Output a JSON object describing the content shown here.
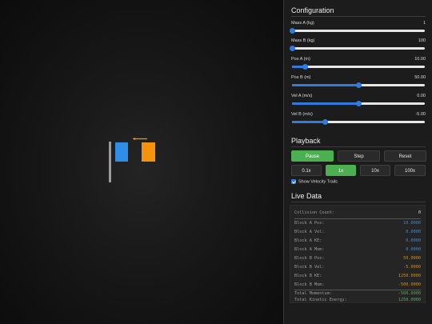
{
  "config": {
    "title": "Configuration",
    "params": [
      {
        "label": "Mass A (kg)",
        "value": "1",
        "fraction": 0.0
      },
      {
        "label": "Mass B (kg)",
        "value": "100",
        "fraction": 0.0
      },
      {
        "label": "Pos A (m)",
        "value": "10.00",
        "fraction": 0.1
      },
      {
        "label": "Pos B (m)",
        "value": "50.00",
        "fraction": 0.5
      },
      {
        "label": "Vel A (m/s)",
        "value": "0.00",
        "fraction": 0.5
      },
      {
        "label": "Vel B (m/s)",
        "value": "-5.00",
        "fraction": 0.25
      }
    ]
  },
  "playback": {
    "title": "Playback",
    "pause": "Pause",
    "step": "Step",
    "reset": "Reset",
    "speeds": [
      "0.1x",
      "1x",
      "10x",
      "100x"
    ],
    "active_speed": "1x",
    "trails_label": "Show Velocity Trails",
    "trails_checked": true
  },
  "live": {
    "title": "Live Data",
    "collision_label": "Collision Count:",
    "collision_value": "0",
    "a_pos_label": "Block A Pos:",
    "a_pos": "10.0000",
    "a_vel_label": "Block A Vel:",
    "a_vel": "0.0000",
    "a_ke_label": "Block A KE:",
    "a_ke": "0.0000",
    "a_mom_label": "Block A Mom:",
    "a_mom": "0.0000",
    "b_pos_label": "Block B Pos:",
    "b_pos": "50.0000",
    "b_vel_label": "Block B Vel:",
    "b_vel": "-5.0000",
    "b_ke_label": "Block B KE:",
    "b_ke": "1250.0000",
    "b_mom_label": "Block B Mom:",
    "b_mom": "-500.0000",
    "total_mom_label": "Total Momentum:",
    "total_mom": "-500.0000",
    "total_ke_label": "Total Kinetic Energy:",
    "total_ke": "1250.0000"
  },
  "colors": {
    "block_a": "#2f8fe8",
    "block_b": "#f5930c",
    "accent": "#2f7be0",
    "active_button": "#4caf50"
  }
}
